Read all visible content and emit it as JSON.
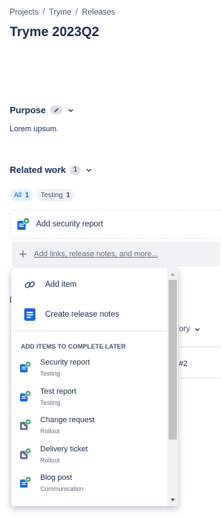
{
  "breadcrumb": {
    "items": [
      "Projects",
      "Tryme",
      "Releases"
    ],
    "separator": "/"
  },
  "page": {
    "title": "Tryme 2023Q2"
  },
  "purpose": {
    "heading": "Purpose",
    "text": "Lorem upsum."
  },
  "related": {
    "heading": "Related work",
    "count": "1",
    "filters": [
      {
        "label": "All",
        "count": "1",
        "selected": true
      },
      {
        "label": "Testing",
        "count": "1",
        "selected": false
      }
    ],
    "item": {
      "label": "Add security report",
      "icon": "report-add-icon"
    },
    "add_link": "Add links, release notes, and more..."
  },
  "background": {
    "letter": "I",
    "column_header": "ory",
    "row_value": "#2"
  },
  "dropdown": {
    "actions": [
      {
        "label": "Add item",
        "icon": "link-icon"
      },
      {
        "label": "Create release notes",
        "icon": "document-icon"
      }
    ],
    "group_title": "ADD ITEMS TO COMPLETE LATER",
    "items": [
      {
        "name": "Security report",
        "sub": "Testing",
        "kind": "blue"
      },
      {
        "name": "Test report",
        "sub": "Testing",
        "kind": "blue"
      },
      {
        "name": "Change request",
        "sub": "Rollout",
        "kind": "gray"
      },
      {
        "name": "Delivery ticket",
        "sub": "Rollout",
        "kind": "gray"
      },
      {
        "name": "Blog post",
        "sub": "Communication",
        "kind": "blue"
      }
    ]
  },
  "colors": {
    "accent": "#0c66e4",
    "icon_blue": "#1868db",
    "icon_gray": "#626f86",
    "badge_green": "#22a06b"
  }
}
